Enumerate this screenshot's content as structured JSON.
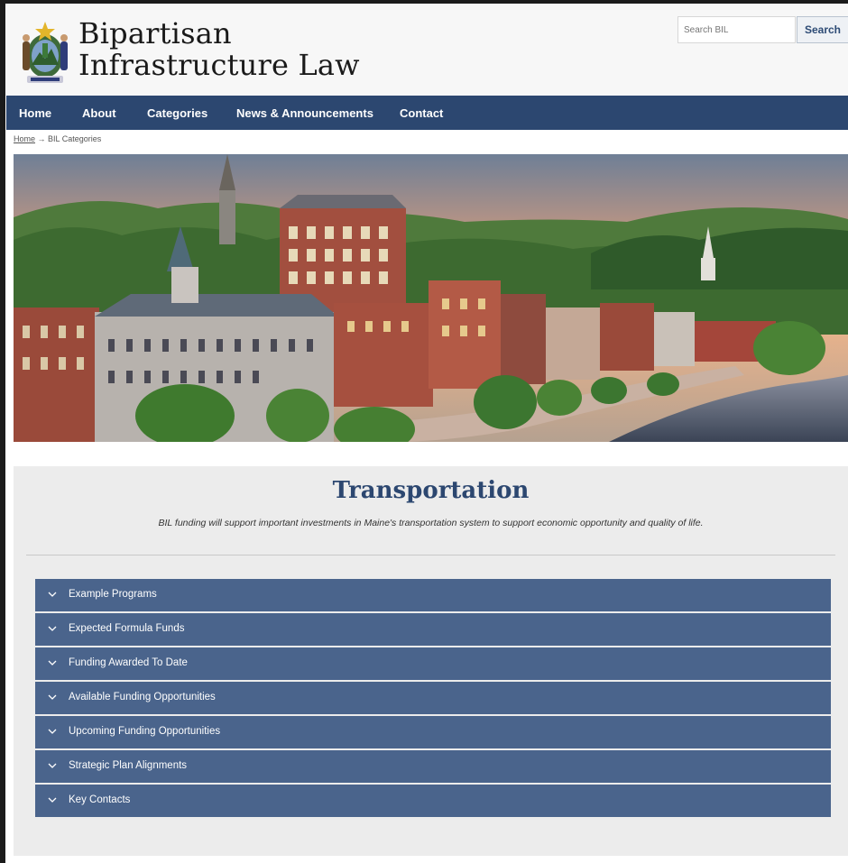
{
  "header": {
    "title_line1": "Bipartisan",
    "title_line2": "Infrastructure Law",
    "search_placeholder": "Search BIL",
    "search_button": "Search"
  },
  "nav": {
    "items": [
      {
        "label": "Home"
      },
      {
        "label": "About"
      },
      {
        "label": "Categories"
      },
      {
        "label": "News & Announcements"
      },
      {
        "label": "Contact"
      }
    ]
  },
  "breadcrumb": {
    "home": "Home",
    "separator": " → ",
    "current": "BIL Categories"
  },
  "category": {
    "title": "Transportation",
    "description": "BIL funding will support important investments in Maine's transportation system to support economic opportunity and quality of life."
  },
  "accordion": {
    "items": [
      {
        "label": "Example Programs"
      },
      {
        "label": "Expected Formula Funds"
      },
      {
        "label": "Funding Awarded To Date"
      },
      {
        "label": "Available Funding Opportunities"
      },
      {
        "label": "Upcoming Funding Opportunities"
      },
      {
        "label": "Strategic Plan Alignments"
      },
      {
        "label": "Key Contacts"
      }
    ]
  },
  "colors": {
    "nav_bg": "#2c4770",
    "accordion_bg": "#4a648c",
    "title_color": "#2c4770",
    "content_bg": "#ececec"
  },
  "icons": {
    "seal": "maine-state-seal-icon",
    "accordion": "chevron-down-icon"
  }
}
